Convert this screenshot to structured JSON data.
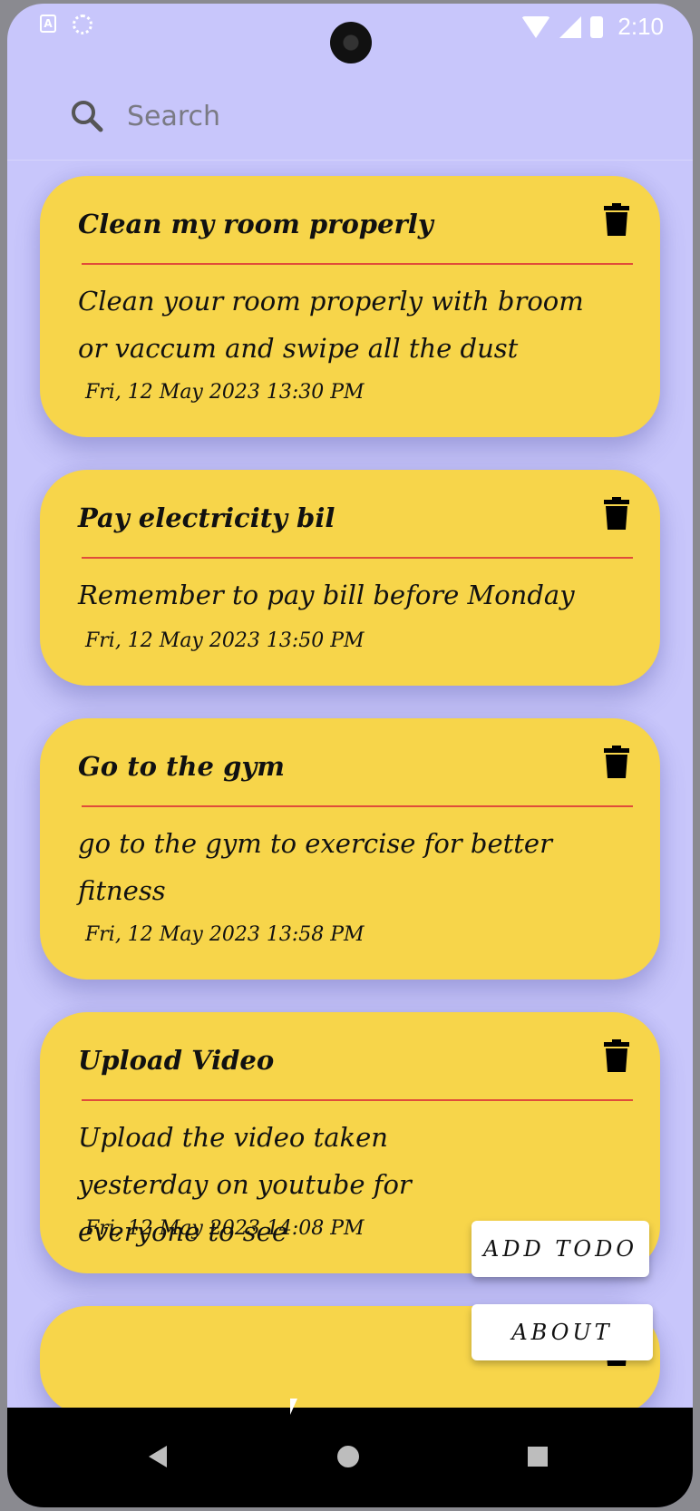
{
  "status_bar": {
    "time": "2:10"
  },
  "search": {
    "placeholder": "Search"
  },
  "todos": [
    {
      "title": "Clean my room properly",
      "description": "Clean your room properly with broom or vaccum and swipe all the dust",
      "date": "Fri, 12 May 2023 13:30 PM"
    },
    {
      "title": "Pay electricity bil",
      "description": "Remember to pay bill before Monday",
      "date": "Fri, 12 May 2023 13:50 PM"
    },
    {
      "title": "Go to the gym",
      "description": "go to the gym to exercise for better fitness",
      "date": "Fri, 12 May 2023 13:58 PM"
    },
    {
      "title": "Upload Video",
      "description": "Upload the video taken yesterday on youtube for everyone to see",
      "date": "Fri, 12 May 2023 14:08 PM"
    }
  ],
  "actions": {
    "add_todo": "ADD TODO",
    "about": "ABOUT"
  },
  "colors": {
    "background": "#c8c6fb",
    "card": "#f7d54a",
    "rule": "#e04c3a"
  },
  "icons": [
    "search-icon",
    "trash-icon",
    "back-icon",
    "home-icon",
    "recents-icon"
  ]
}
